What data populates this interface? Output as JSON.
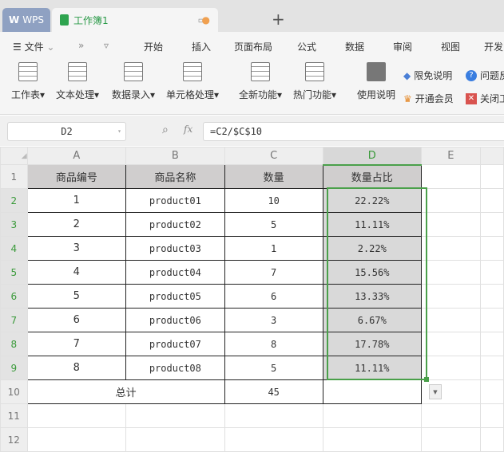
{
  "tabs": {
    "app": "WPS",
    "doc": "工作簿1"
  },
  "menu": [
    "文件",
    "开始",
    "插入",
    "页面布局",
    "公式",
    "数据",
    "审阅",
    "视图",
    "开发"
  ],
  "tools": [
    "工作表",
    "文本处理",
    "数据录入",
    "单元格处理",
    "全新功能",
    "热门功能",
    "使用说明"
  ],
  "side": [
    "限免说明",
    "问题反",
    "开通会员",
    "关闭工"
  ],
  "namebox": "D2",
  "fx": "fx",
  "formula": "=C2/$C$10",
  "columns": [
    "A",
    "B",
    "C",
    "D",
    "E"
  ],
  "header": [
    "商品编号",
    "商品名称",
    "数量",
    "数量占比"
  ],
  "rows": [
    [
      "1",
      "product01",
      "10",
      "22.22%"
    ],
    [
      "2",
      "product02",
      "5",
      "11.11%"
    ],
    [
      "3",
      "product03",
      "1",
      "2.22%"
    ],
    [
      "4",
      "product04",
      "7",
      "15.56%"
    ],
    [
      "5",
      "product05",
      "6",
      "13.33%"
    ],
    [
      "6",
      "product06",
      "3",
      "6.67%"
    ],
    [
      "7",
      "product07",
      "8",
      "17.78%"
    ],
    [
      "8",
      "product08",
      "5",
      "11.11%"
    ]
  ],
  "total": {
    "label": "总计",
    "value": "45"
  },
  "row_numbers": [
    "1",
    "2",
    "3",
    "4",
    "5",
    "6",
    "7",
    "8",
    "9",
    "10",
    "11",
    "12"
  ],
  "colors": {
    "accent": "#4aa04a",
    "header_fill": "#d0cece"
  }
}
